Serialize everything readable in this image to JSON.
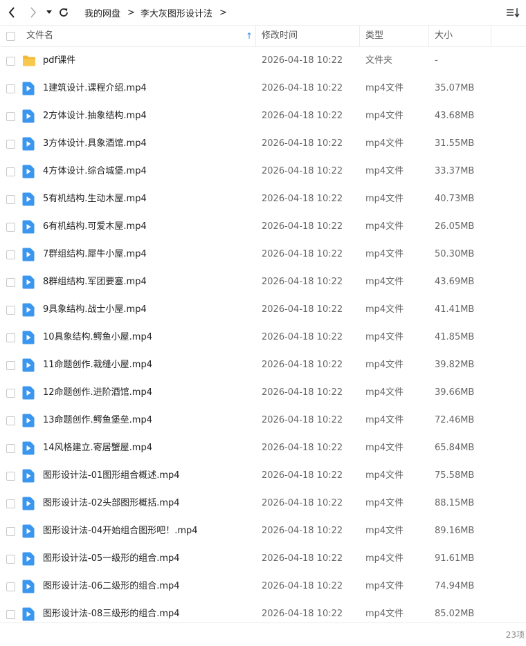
{
  "toolbar": {
    "back_icon": "chevron-left-icon",
    "forward_icon": "chevron-right-icon",
    "history_icon": "caret-down-icon",
    "refresh_icon": "refresh-icon",
    "sort_icon": "sort-list-icon"
  },
  "breadcrumb": {
    "root": "我的网盘",
    "sep1": ">",
    "current": "李大灰图形设计法",
    "sep2": ">"
  },
  "columns": {
    "name": "文件名",
    "modified": "修改时间",
    "type": "类型",
    "size": "大小",
    "sort_indicator": "↑"
  },
  "colors": {
    "folder": "#f5b935",
    "video": "#3a96ee",
    "sort_arrow": "#2f8ff0"
  },
  "files": [
    {
      "name": "pdf课件",
      "modified": "2026-04-18 10:22",
      "type": "文件夹",
      "size": "-",
      "icon": "folder-icon"
    },
    {
      "name": "1建筑设计.课程介绍.mp4",
      "modified": "2026-04-18 10:22",
      "type": "mp4文件",
      "size": "35.07MB",
      "icon": "video-file-icon"
    },
    {
      "name": "2方体设计.抽象结构.mp4",
      "modified": "2026-04-18 10:22",
      "type": "mp4文件",
      "size": "43.68MB",
      "icon": "video-file-icon"
    },
    {
      "name": "3方体设计.具象酒馆.mp4",
      "modified": "2026-04-18 10:22",
      "type": "mp4文件",
      "size": "31.55MB",
      "icon": "video-file-icon"
    },
    {
      "name": "4方体设计.综合城堡.mp4",
      "modified": "2026-04-18 10:22",
      "type": "mp4文件",
      "size": "33.37MB",
      "icon": "video-file-icon"
    },
    {
      "name": "5有机结构.生动木屋.mp4",
      "modified": "2026-04-18 10:22",
      "type": "mp4文件",
      "size": "40.73MB",
      "icon": "video-file-icon"
    },
    {
      "name": "6有机结构.可爱木屋.mp4",
      "modified": "2026-04-18 10:22",
      "type": "mp4文件",
      "size": "26.05MB",
      "icon": "video-file-icon"
    },
    {
      "name": "7群组结构.犀牛小屋.mp4",
      "modified": "2026-04-18 10:22",
      "type": "mp4文件",
      "size": "50.30MB",
      "icon": "video-file-icon"
    },
    {
      "name": "8群组结构.军团要塞.mp4",
      "modified": "2026-04-18 10:22",
      "type": "mp4文件",
      "size": "43.69MB",
      "icon": "video-file-icon"
    },
    {
      "name": "9具象结构.战士小屋.mp4",
      "modified": "2026-04-18 10:22",
      "type": "mp4文件",
      "size": "41.41MB",
      "icon": "video-file-icon"
    },
    {
      "name": "10具象结构.鳄鱼小屋.mp4",
      "modified": "2026-04-18 10:22",
      "type": "mp4文件",
      "size": "41.85MB",
      "icon": "video-file-icon"
    },
    {
      "name": "11命题创作.裁缝小屋.mp4",
      "modified": "2026-04-18 10:22",
      "type": "mp4文件",
      "size": "39.82MB",
      "icon": "video-file-icon"
    },
    {
      "name": "12命题创作.进阶酒馆.mp4",
      "modified": "2026-04-18 10:22",
      "type": "mp4文件",
      "size": "39.66MB",
      "icon": "video-file-icon"
    },
    {
      "name": "13命题创作.鳄鱼堡垒.mp4",
      "modified": "2026-04-18 10:22",
      "type": "mp4文件",
      "size": "72.46MB",
      "icon": "video-file-icon"
    },
    {
      "name": "14风格建立.寄居蟹屋.mp4",
      "modified": "2026-04-18 10:22",
      "type": "mp4文件",
      "size": "65.84MB",
      "icon": "video-file-icon"
    },
    {
      "name": "图形设计法-01图形组合概述.mp4",
      "modified": "2026-04-18 10:22",
      "type": "mp4文件",
      "size": "75.58MB",
      "icon": "video-file-icon"
    },
    {
      "name": "图形设计法-02头部图形概括.mp4",
      "modified": "2026-04-18 10:22",
      "type": "mp4文件",
      "size": "88.15MB",
      "icon": "video-file-icon"
    },
    {
      "name": "图形设计法-04开始组合图形吧！.mp4",
      "modified": "2026-04-18 10:22",
      "type": "mp4文件",
      "size": "89.16MB",
      "icon": "video-file-icon"
    },
    {
      "name": "图形设计法-05一级形的组合.mp4",
      "modified": "2026-04-18 10:22",
      "type": "mp4文件",
      "size": "91.61MB",
      "icon": "video-file-icon"
    },
    {
      "name": "图形设计法-06二级形的组合.mp4",
      "modified": "2026-04-18 10:22",
      "type": "mp4文件",
      "size": "74.94MB",
      "icon": "video-file-icon"
    },
    {
      "name": "图形设计法-08三级形的组合.mp4",
      "modified": "2026-04-18 10:22",
      "type": "mp4文件",
      "size": "85.02MB",
      "icon": "video-file-icon"
    }
  ],
  "footer": {
    "item_count": "23项"
  }
}
